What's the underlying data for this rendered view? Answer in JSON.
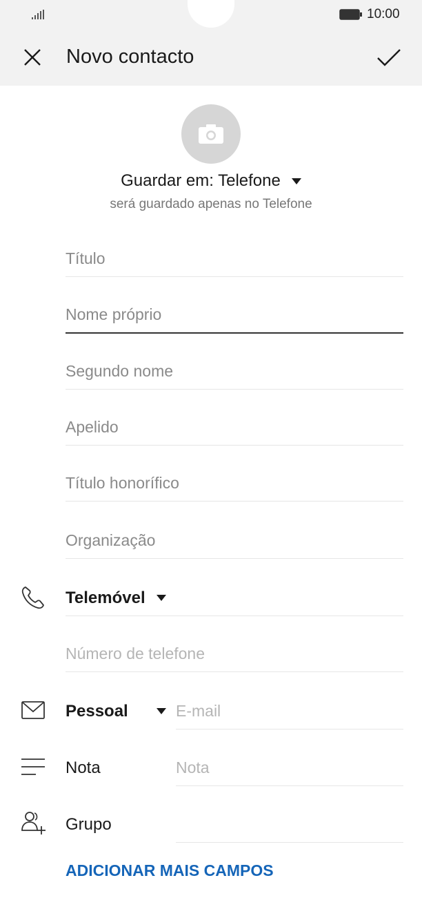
{
  "status_bar": {
    "time": "10:00"
  },
  "header": {
    "title": "Novo contacto"
  },
  "storage": {
    "label": "Guardar em: Telefone",
    "note": "será guardado apenas no Telefone"
  },
  "fields": {
    "titulo": "Título",
    "nome_proprio": "Nome próprio",
    "segundo_nome": "Segundo nome",
    "apelido": "Apelido",
    "titulo_honorifico": "Título honorífico",
    "organizacao": "Organização"
  },
  "phone": {
    "type_label": "Telemóvel",
    "placeholder": "Número de telefone"
  },
  "email": {
    "type_label": "Pessoal",
    "placeholder": "E-mail"
  },
  "note": {
    "label": "Nota",
    "placeholder": "Nota"
  },
  "group": {
    "label": "Grupo",
    "value": ""
  },
  "actions": {
    "add_more": "ADICIONAR MAIS CAMPOS"
  },
  "colors": {
    "accent": "#1565b8",
    "header_bg": "#f2f2f2",
    "avatar_bg": "#d6d6d6"
  }
}
